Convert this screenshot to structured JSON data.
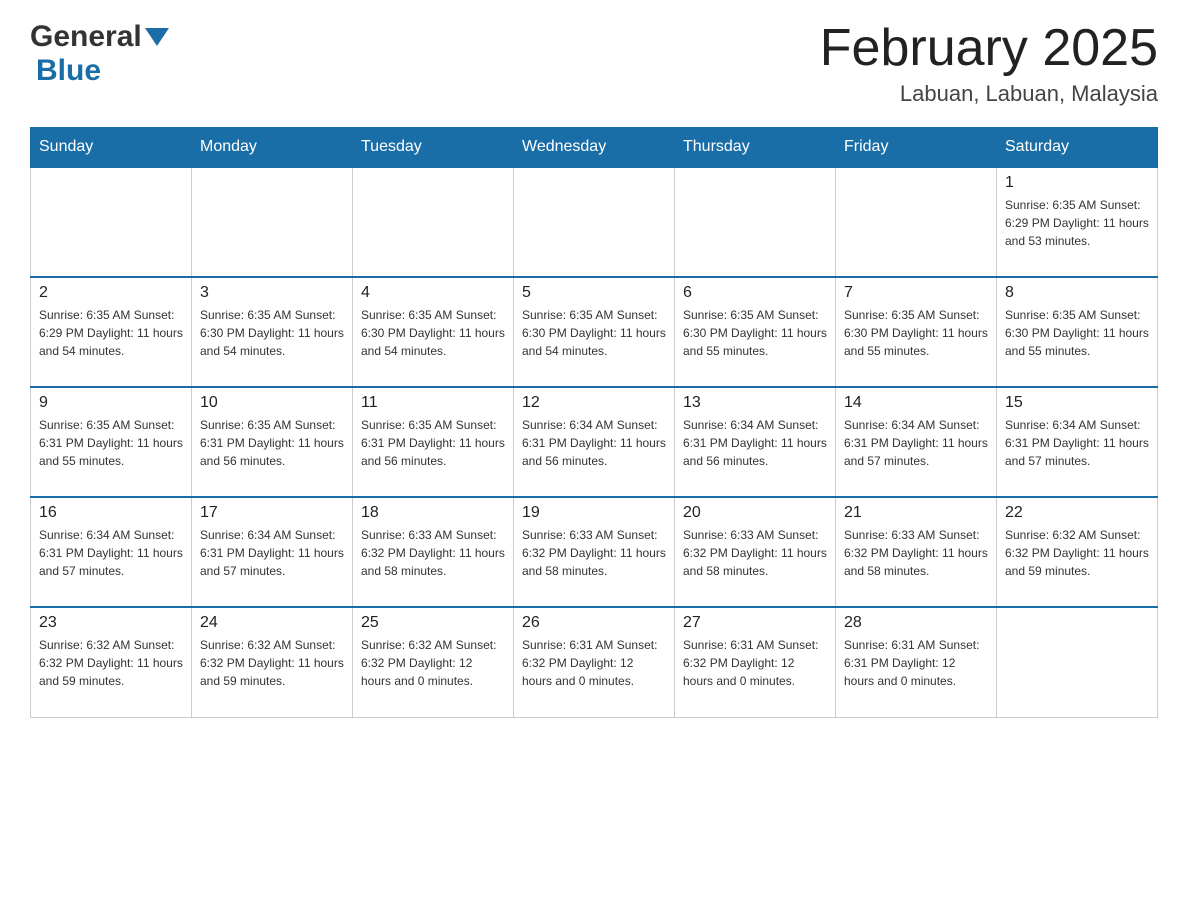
{
  "header": {
    "logo_general": "General",
    "logo_blue": "Blue",
    "month_title": "February 2025",
    "location": "Labuan, Labuan, Malaysia"
  },
  "days_of_week": [
    "Sunday",
    "Monday",
    "Tuesday",
    "Wednesday",
    "Thursday",
    "Friday",
    "Saturday"
  ],
  "weeks": [
    {
      "days": [
        {
          "num": "",
          "info": ""
        },
        {
          "num": "",
          "info": ""
        },
        {
          "num": "",
          "info": ""
        },
        {
          "num": "",
          "info": ""
        },
        {
          "num": "",
          "info": ""
        },
        {
          "num": "",
          "info": ""
        },
        {
          "num": "1",
          "info": "Sunrise: 6:35 AM\nSunset: 6:29 PM\nDaylight: 11 hours\nand 53 minutes."
        }
      ]
    },
    {
      "days": [
        {
          "num": "2",
          "info": "Sunrise: 6:35 AM\nSunset: 6:29 PM\nDaylight: 11 hours\nand 54 minutes."
        },
        {
          "num": "3",
          "info": "Sunrise: 6:35 AM\nSunset: 6:30 PM\nDaylight: 11 hours\nand 54 minutes."
        },
        {
          "num": "4",
          "info": "Sunrise: 6:35 AM\nSunset: 6:30 PM\nDaylight: 11 hours\nand 54 minutes."
        },
        {
          "num": "5",
          "info": "Sunrise: 6:35 AM\nSunset: 6:30 PM\nDaylight: 11 hours\nand 54 minutes."
        },
        {
          "num": "6",
          "info": "Sunrise: 6:35 AM\nSunset: 6:30 PM\nDaylight: 11 hours\nand 55 minutes."
        },
        {
          "num": "7",
          "info": "Sunrise: 6:35 AM\nSunset: 6:30 PM\nDaylight: 11 hours\nand 55 minutes."
        },
        {
          "num": "8",
          "info": "Sunrise: 6:35 AM\nSunset: 6:30 PM\nDaylight: 11 hours\nand 55 minutes."
        }
      ]
    },
    {
      "days": [
        {
          "num": "9",
          "info": "Sunrise: 6:35 AM\nSunset: 6:31 PM\nDaylight: 11 hours\nand 55 minutes."
        },
        {
          "num": "10",
          "info": "Sunrise: 6:35 AM\nSunset: 6:31 PM\nDaylight: 11 hours\nand 56 minutes."
        },
        {
          "num": "11",
          "info": "Sunrise: 6:35 AM\nSunset: 6:31 PM\nDaylight: 11 hours\nand 56 minutes."
        },
        {
          "num": "12",
          "info": "Sunrise: 6:34 AM\nSunset: 6:31 PM\nDaylight: 11 hours\nand 56 minutes."
        },
        {
          "num": "13",
          "info": "Sunrise: 6:34 AM\nSunset: 6:31 PM\nDaylight: 11 hours\nand 56 minutes."
        },
        {
          "num": "14",
          "info": "Sunrise: 6:34 AM\nSunset: 6:31 PM\nDaylight: 11 hours\nand 57 minutes."
        },
        {
          "num": "15",
          "info": "Sunrise: 6:34 AM\nSunset: 6:31 PM\nDaylight: 11 hours\nand 57 minutes."
        }
      ]
    },
    {
      "days": [
        {
          "num": "16",
          "info": "Sunrise: 6:34 AM\nSunset: 6:31 PM\nDaylight: 11 hours\nand 57 minutes."
        },
        {
          "num": "17",
          "info": "Sunrise: 6:34 AM\nSunset: 6:31 PM\nDaylight: 11 hours\nand 57 minutes."
        },
        {
          "num": "18",
          "info": "Sunrise: 6:33 AM\nSunset: 6:32 PM\nDaylight: 11 hours\nand 58 minutes."
        },
        {
          "num": "19",
          "info": "Sunrise: 6:33 AM\nSunset: 6:32 PM\nDaylight: 11 hours\nand 58 minutes."
        },
        {
          "num": "20",
          "info": "Sunrise: 6:33 AM\nSunset: 6:32 PM\nDaylight: 11 hours\nand 58 minutes."
        },
        {
          "num": "21",
          "info": "Sunrise: 6:33 AM\nSunset: 6:32 PM\nDaylight: 11 hours\nand 58 minutes."
        },
        {
          "num": "22",
          "info": "Sunrise: 6:32 AM\nSunset: 6:32 PM\nDaylight: 11 hours\nand 59 minutes."
        }
      ]
    },
    {
      "days": [
        {
          "num": "23",
          "info": "Sunrise: 6:32 AM\nSunset: 6:32 PM\nDaylight: 11 hours\nand 59 minutes."
        },
        {
          "num": "24",
          "info": "Sunrise: 6:32 AM\nSunset: 6:32 PM\nDaylight: 11 hours\nand 59 minutes."
        },
        {
          "num": "25",
          "info": "Sunrise: 6:32 AM\nSunset: 6:32 PM\nDaylight: 12 hours\nand 0 minutes."
        },
        {
          "num": "26",
          "info": "Sunrise: 6:31 AM\nSunset: 6:32 PM\nDaylight: 12 hours\nand 0 minutes."
        },
        {
          "num": "27",
          "info": "Sunrise: 6:31 AM\nSunset: 6:32 PM\nDaylight: 12 hours\nand 0 minutes."
        },
        {
          "num": "28",
          "info": "Sunrise: 6:31 AM\nSunset: 6:31 PM\nDaylight: 12 hours\nand 0 minutes."
        },
        {
          "num": "",
          "info": ""
        }
      ]
    }
  ]
}
